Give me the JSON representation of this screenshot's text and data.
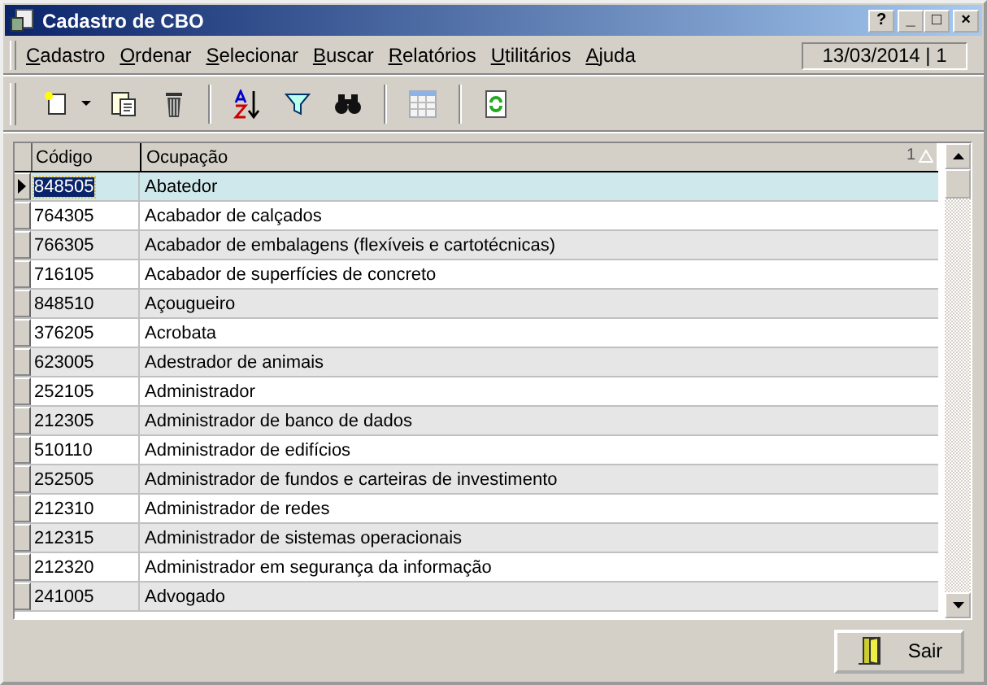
{
  "window": {
    "title": "Cadastro de CBO",
    "controls": [
      "?",
      "_",
      "□",
      "×"
    ]
  },
  "menu": [
    "Cadastro",
    "Ordenar",
    "Selecionar",
    "Buscar",
    "Relatórios",
    "Utilitários",
    "Ajuda"
  ],
  "status": "13/03/2014 | 1",
  "table": {
    "columns": [
      "Código",
      "Ocupação"
    ],
    "sort_label": "1",
    "rows": [
      {
        "code": "848505",
        "name": "Abatedor",
        "selected": true
      },
      {
        "code": "764305",
        "name": "Acabador de calçados",
        "selected": false
      },
      {
        "code": "766305",
        "name": "Acabador de embalagens (flexíveis e cartotécnicas)",
        "selected": false
      },
      {
        "code": "716105",
        "name": "Acabador de superfícies de concreto",
        "selected": false
      },
      {
        "code": "848510",
        "name": "Açougueiro",
        "selected": false
      },
      {
        "code": "376205",
        "name": "Acrobata",
        "selected": false
      },
      {
        "code": "623005",
        "name": "Adestrador de animais",
        "selected": false
      },
      {
        "code": "252105",
        "name": "Administrador",
        "selected": false
      },
      {
        "code": "212305",
        "name": "Administrador de banco de dados",
        "selected": false
      },
      {
        "code": "510110",
        "name": "Administrador de edifícios",
        "selected": false
      },
      {
        "code": "252505",
        "name": "Administrador de fundos e carteiras de investimento",
        "selected": false
      },
      {
        "code": "212310",
        "name": "Administrador de redes",
        "selected": false
      },
      {
        "code": "212315",
        "name": "Administrador de sistemas operacionais",
        "selected": false
      },
      {
        "code": "212320",
        "name": "Administrador em segurança da informação",
        "selected": false
      },
      {
        "code": "241005",
        "name": "Advogado",
        "selected": false
      }
    ]
  },
  "exit_button": "Sair"
}
